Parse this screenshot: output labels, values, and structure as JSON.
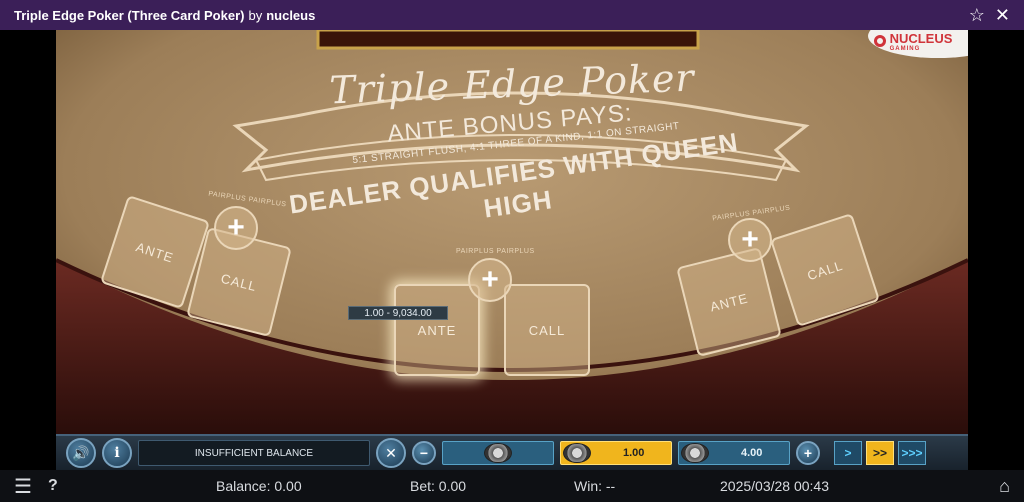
{
  "titlebar": {
    "title": "Triple Edge Poker (Three Card Poker)",
    "by": "by",
    "brand": "nucleus",
    "favorite_icon": "star-outline-icon",
    "close_icon": "close-icon"
  },
  "table": {
    "logo": "NUCLEUS",
    "logo_sub": "GAMING",
    "game_title": "Triple Edge Poker",
    "ante_bonus": "ANTE BONUS PAYS:",
    "bonus_details": "5:1 STRAIGHT FLUSH, 4:1 THREE OF A KIND, 1:1 ON STRAIGHT",
    "dealer_rule": "DEALER QUALIFIES WITH QUEEN HIGH",
    "pairplus": "PAIRPLUS PAIRPLUS",
    "plus": "+",
    "spots": [
      {
        "ante": "ANTE",
        "call": "CALL"
      },
      {
        "ante": "ANTE",
        "call": "CALL"
      },
      {
        "ante": "ANTE",
        "call": "CALL"
      }
    ],
    "bet_range": "1.00 - 9,034.00"
  },
  "controls": {
    "status": "INSUFFICIENT BALANCE",
    "minus": "−",
    "plus": "+",
    "selected_chip": "1.00",
    "other_chip": "4.00",
    "speed": [
      ">",
      ">>",
      ">>>"
    ]
  },
  "footer": {
    "balance": "Balance: 0.00",
    "bet": "Bet: 0.00",
    "win": "Win: --",
    "datetime": "2025/03/28 00:43"
  },
  "colors": {
    "titlebar": "#3b1f58",
    "felt": "#a88a64",
    "rail": "#5a1f1a",
    "chip_selected": "#f0b51d",
    "brand_red": "#d0343a"
  }
}
